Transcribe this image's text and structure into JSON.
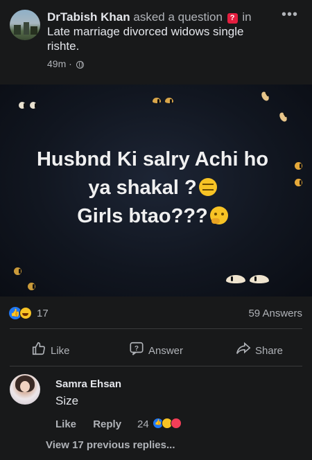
{
  "post": {
    "author": "DrTabish Khan",
    "action_text": "asked a question",
    "in_text": "in",
    "group": "Late marriage divorced widows single rishte.",
    "time": "49m",
    "more_icon": "more-options-icon",
    "banner": {
      "line1": "Husbnd Ki salry Achi ho",
      "line2": "ya shakal ?",
      "line3": "Girls btao???",
      "emoji_line2": "expressionless-face-emoji",
      "emoji_line3": "thinking-face-emoji",
      "background": "#121722"
    }
  },
  "stats": {
    "reaction_count": "17",
    "answers": "59 Answers",
    "reactions": [
      "like",
      "haha"
    ]
  },
  "actions": {
    "like": "Like",
    "answer": "Answer",
    "share": "Share"
  },
  "comment": {
    "author": "Samra Ehsan",
    "text": "Size",
    "like": "Like",
    "reply": "Reply",
    "reaction_count": "24",
    "reactions": [
      "like",
      "haha",
      "love"
    ]
  },
  "view_replies": "View 17 previous replies...",
  "colors": {
    "background": "#18191a",
    "primary_text": "#e4e6eb",
    "secondary_text": "#b0b3b8",
    "like_blue": "#2078f4",
    "question_red": "#e41e3f"
  }
}
